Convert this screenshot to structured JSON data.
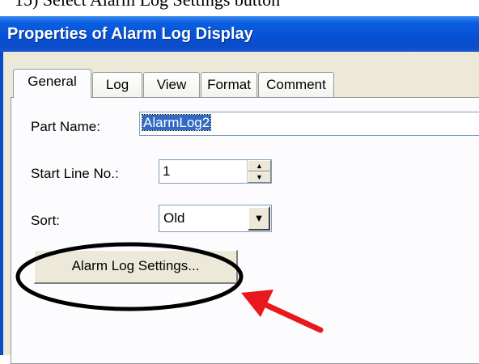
{
  "doc_caption": "15) Select Alarm Log Settings button",
  "window": {
    "title": "Properties of Alarm Log Display"
  },
  "tabs": [
    {
      "label": "General",
      "active": true
    },
    {
      "label": "Log",
      "active": false
    },
    {
      "label": "View",
      "active": false
    },
    {
      "label": "Format",
      "active": false
    },
    {
      "label": "Comment",
      "active": false
    }
  ],
  "fields": {
    "part_name": {
      "label": "Part Name:",
      "value": "AlarmLog2"
    },
    "start_line": {
      "label": "Start Line No.:",
      "value": "1"
    },
    "sort": {
      "label": "Sort:",
      "value": "Old"
    }
  },
  "alarm_log_button": {
    "label": "Alarm Log Settings..."
  },
  "annotations": {
    "highlight_color": "#000000",
    "arrow_color": "#e8181c"
  }
}
